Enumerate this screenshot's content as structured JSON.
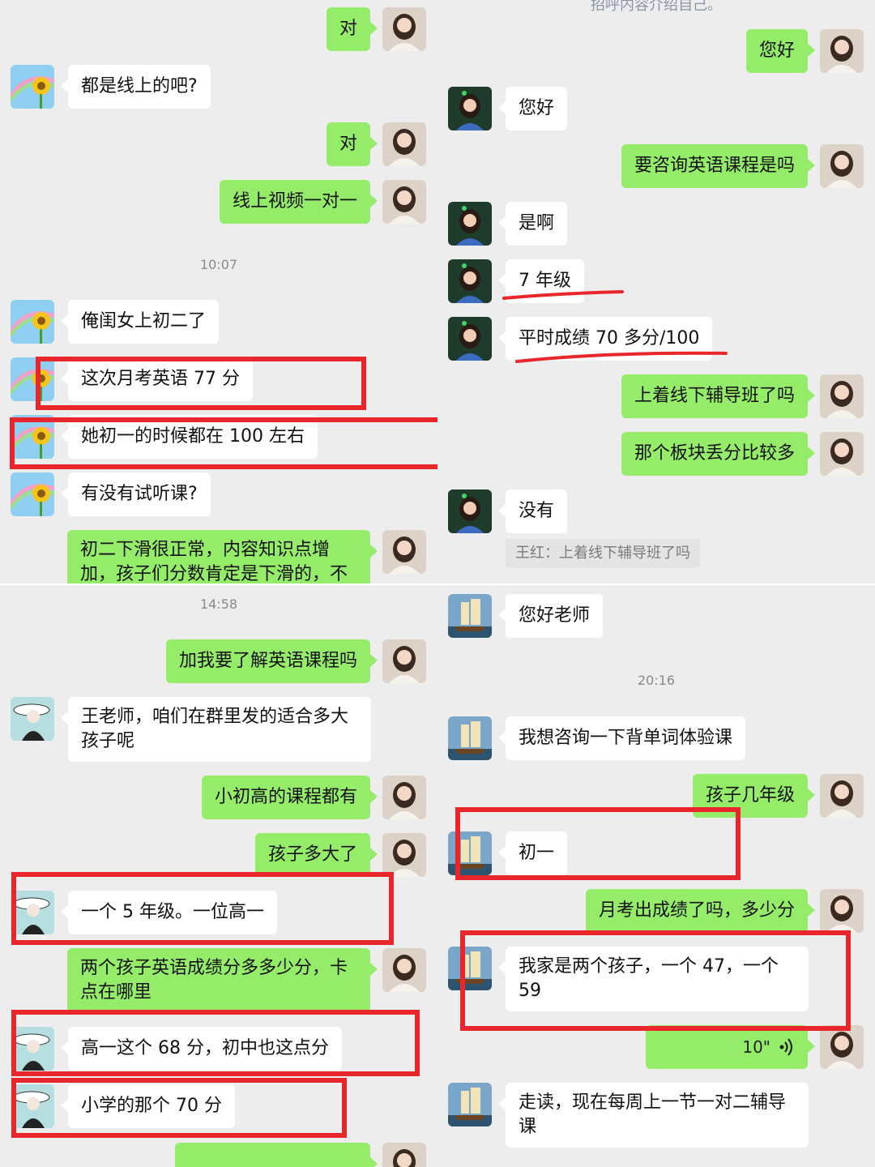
{
  "panels": {
    "top_left": {
      "messages": [
        {
          "side": "out",
          "avatar": "woman-icon",
          "text": "对"
        },
        {
          "side": "in",
          "avatar": "sunflower-icon",
          "text": "都是线上的吧?"
        },
        {
          "side": "out",
          "avatar": "woman-icon",
          "text": "对"
        },
        {
          "side": "out",
          "avatar": "woman-icon",
          "text": "线上视频一对一"
        },
        {
          "type": "time",
          "text": "10:07"
        },
        {
          "side": "in",
          "avatar": "sunflower-icon",
          "text": "俺闺女上初二了"
        },
        {
          "side": "in",
          "avatar": "sunflower-icon",
          "text": "这次月考英语 77 分"
        },
        {
          "side": "in",
          "avatar": "sunflower-icon",
          "text": "她初一的时候都在 100 左右"
        },
        {
          "side": "in",
          "avatar": "sunflower-icon",
          "text": "有没有试听课?"
        },
        {
          "side": "out",
          "avatar": "woman-icon",
          "text": "初二下滑很正常，内容知识点增加，孩子们分数肯定是下滑的，不"
        }
      ]
    },
    "top_right": {
      "system_note": "招呼内容介绍自己。",
      "messages": [
        {
          "side": "out",
          "avatar": "woman-icon",
          "text": "您好"
        },
        {
          "side": "in",
          "avatar": "girl-icon",
          "text": "您好"
        },
        {
          "side": "out",
          "avatar": "woman-icon",
          "text": "要咨询英语课程是吗"
        },
        {
          "side": "in",
          "avatar": "girl-icon",
          "text": "是啊"
        },
        {
          "side": "in",
          "avatar": "girl-icon",
          "text": "7 年级"
        },
        {
          "side": "in",
          "avatar": "girl-icon",
          "text": "平时成绩 70 多分/100"
        },
        {
          "side": "out",
          "avatar": "woman-icon",
          "text": "上着线下辅导班了吗"
        },
        {
          "side": "out",
          "avatar": "woman-icon",
          "text": "那个板块丢分比较多"
        },
        {
          "side": "in",
          "avatar": "girl-icon",
          "text": "没有"
        },
        {
          "type": "quote",
          "text": "王红：上着线下辅导班了吗"
        }
      ]
    },
    "bottom_left": {
      "messages": [
        {
          "type": "time",
          "text": "14:58"
        },
        {
          "side": "out",
          "avatar": "woman-icon",
          "text": "加我要了解英语课程吗"
        },
        {
          "side": "in",
          "avatar": "lady-hat-icon",
          "text": "王老师，咱们在群里发的适合多大孩子呢"
        },
        {
          "side": "out",
          "avatar": "woman-icon",
          "text": "小初高的课程都有"
        },
        {
          "side": "out",
          "avatar": "woman-icon",
          "text": "孩子多大了"
        },
        {
          "side": "in",
          "avatar": "lady-hat-icon",
          "text": "一个 5 年级。一位高一"
        },
        {
          "side": "out",
          "avatar": "woman-icon",
          "text": "两个孩子英语成绩分多多少分，卡点在哪里"
        },
        {
          "side": "in",
          "avatar": "lady-hat-icon",
          "text": "高一这个 68 分，初中也这点分"
        },
        {
          "side": "in",
          "avatar": "lady-hat-icon",
          "text": "小学的那个 70 分"
        }
      ]
    },
    "bottom_right": {
      "messages": [
        {
          "side": "in",
          "avatar": "ship-icon",
          "text": "您好老师"
        },
        {
          "type": "time",
          "text": "20:16"
        },
        {
          "side": "in",
          "avatar": "ship-icon",
          "text": "我想咨询一下背单词体验课"
        },
        {
          "side": "out",
          "avatar": "woman-icon",
          "text": "孩子几年级"
        },
        {
          "side": "in",
          "avatar": "ship-icon",
          "text": "初一"
        },
        {
          "side": "out",
          "avatar": "woman-icon",
          "text": "月考出成绩了吗，多少分"
        },
        {
          "side": "in",
          "avatar": "ship-icon",
          "text": "我家是两个孩子，一个 47，一个59"
        },
        {
          "side": "out",
          "avatar": "woman-icon",
          "type": "voice",
          "duration": "10\"",
          "icon": "voice-wave-icon"
        },
        {
          "side": "in",
          "avatar": "ship-icon",
          "text": "走读，现在每周上一节一对二辅导课"
        }
      ]
    }
  },
  "colors": {
    "background": "#ededed",
    "bubble_out": "#95ec69",
    "bubble_in": "#ffffff",
    "highlight": "#e8262b"
  }
}
